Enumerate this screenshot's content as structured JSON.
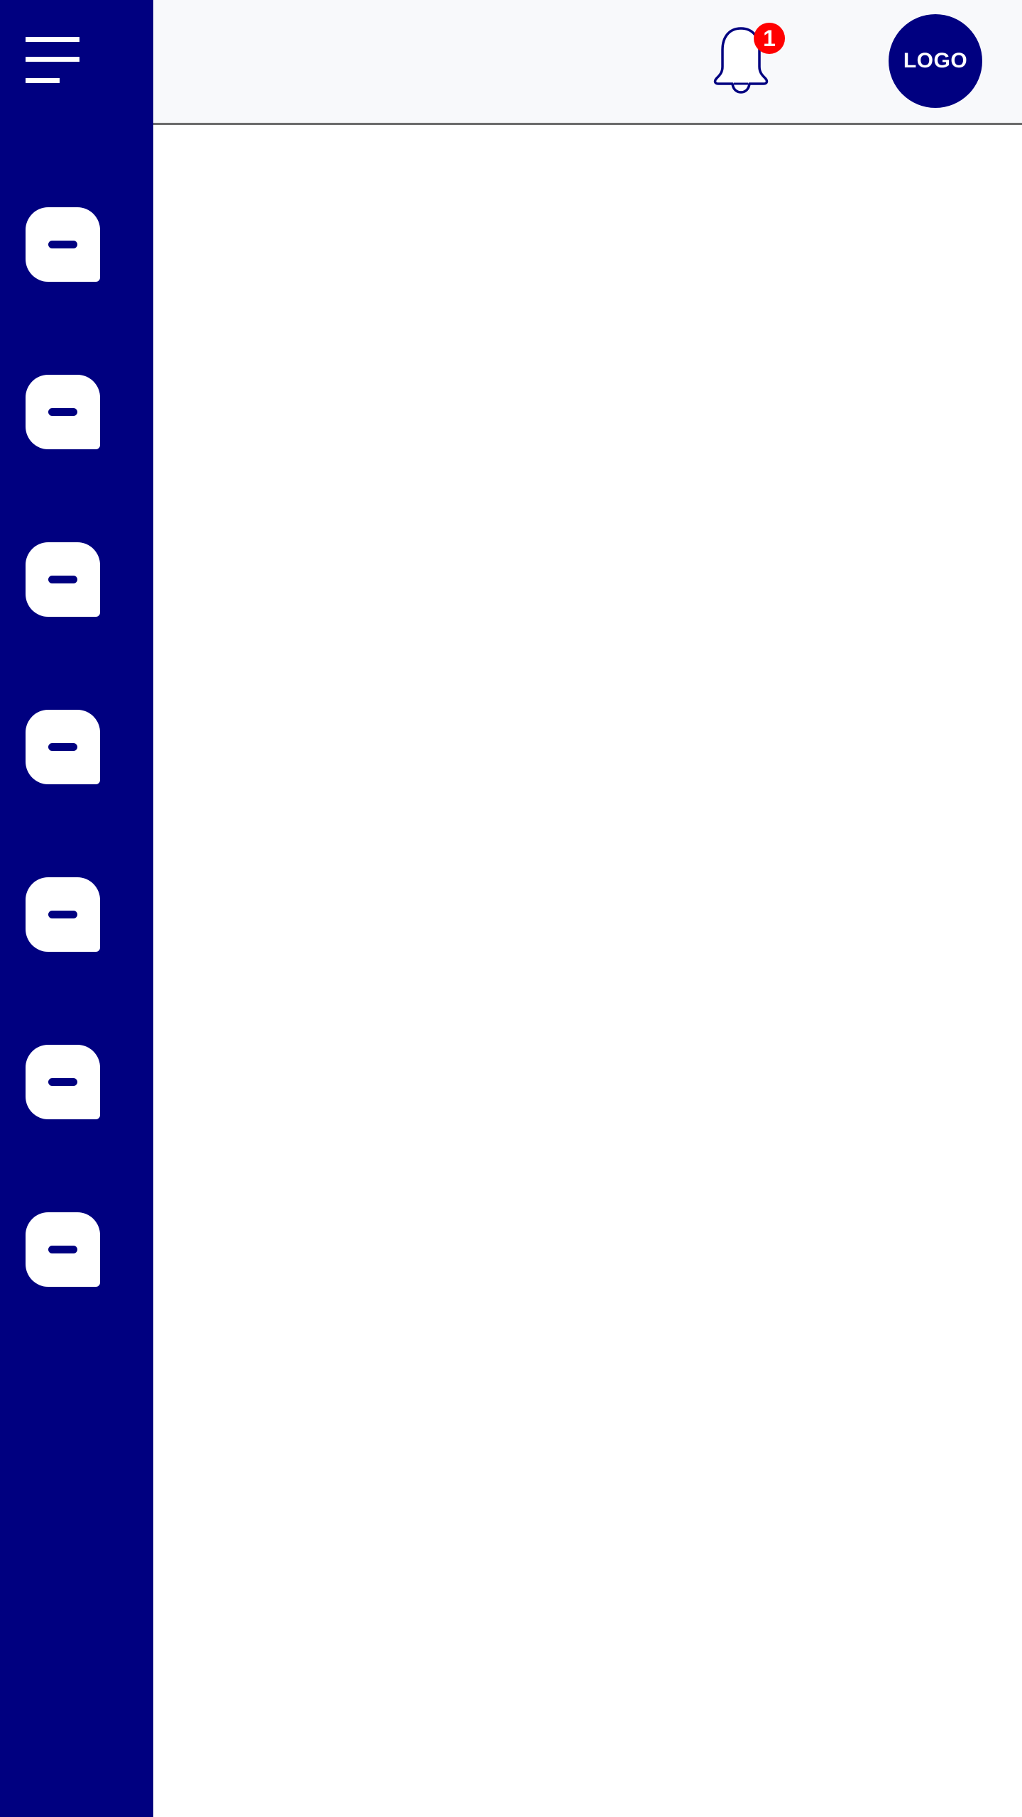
{
  "colors": {
    "sidebar": "#000080",
    "header_bg": "#f8f9fb",
    "badge": "#ff0000",
    "logo_bg": "#000080",
    "icon_fill": "#ffffff"
  },
  "sidebar": {
    "menu_icon": "hamburger-menu-icon",
    "items": [
      {
        "icon": "chat-bubble-icon"
      },
      {
        "icon": "chat-bubble-icon"
      },
      {
        "icon": "chat-bubble-icon"
      },
      {
        "icon": "chat-bubble-icon"
      },
      {
        "icon": "chat-bubble-icon"
      },
      {
        "icon": "chat-bubble-icon"
      },
      {
        "icon": "chat-bubble-icon"
      }
    ]
  },
  "header": {
    "notifications": {
      "icon": "bell-icon",
      "count": "1"
    },
    "logo": {
      "text": "LOGO"
    }
  }
}
